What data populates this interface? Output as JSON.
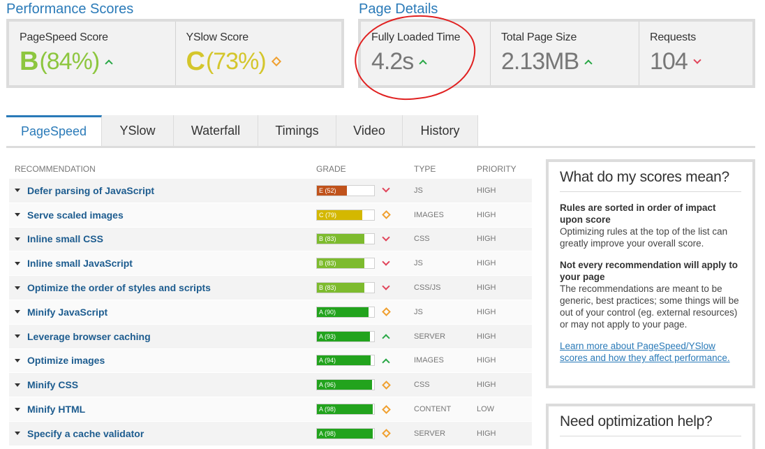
{
  "performance": {
    "title": "Performance Scores",
    "pagespeed": {
      "label": "PageSpeed Score",
      "grade": "B",
      "percent": "(84%)",
      "color": "#8dc63f",
      "trend": "up"
    },
    "yslow": {
      "label": "YSlow Score",
      "grade": "C",
      "percent": "(73%)",
      "color": "#d4c62c",
      "trend": "neutral"
    }
  },
  "details": {
    "title": "Page Details",
    "load_time": {
      "label": "Fully Loaded Time",
      "value": "4.2s",
      "trend": "up"
    },
    "page_size": {
      "label": "Total Page Size",
      "value": "2.13MB",
      "trend": "up"
    },
    "requests": {
      "label": "Requests",
      "value": "104",
      "trend": "down"
    }
  },
  "tabs": [
    {
      "label": "PageSpeed",
      "active": true
    },
    {
      "label": "YSlow"
    },
    {
      "label": "Waterfall"
    },
    {
      "label": "Timings"
    },
    {
      "label": "Video"
    },
    {
      "label": "History"
    }
  ],
  "table": {
    "headers": {
      "recommendation": "RECOMMENDATION",
      "grade": "GRADE",
      "type": "TYPE",
      "priority": "PRIORITY"
    },
    "rows": [
      {
        "name": "Defer parsing of JavaScript",
        "grade": "E (52)",
        "score": 52,
        "color": "#c0521b",
        "trend": "down",
        "type": "JS",
        "priority": "HIGH"
      },
      {
        "name": "Serve scaled images",
        "grade": "C (79)",
        "score": 79,
        "color": "#d4b800",
        "trend": "neutral",
        "type": "IMAGES",
        "priority": "HIGH"
      },
      {
        "name": "Inline small CSS",
        "grade": "B (83)",
        "score": 83,
        "color": "#7dbb2e",
        "trend": "down",
        "type": "CSS",
        "priority": "HIGH"
      },
      {
        "name": "Inline small JavaScript",
        "grade": "B (83)",
        "score": 83,
        "color": "#7dbb2e",
        "trend": "down",
        "type": "JS",
        "priority": "HIGH"
      },
      {
        "name": "Optimize the order of styles and scripts",
        "grade": "B (83)",
        "score": 83,
        "color": "#7dbb2e",
        "trend": "down",
        "type": "CSS/JS",
        "priority": "HIGH"
      },
      {
        "name": "Minify JavaScript",
        "grade": "A (90)",
        "score": 90,
        "color": "#22a31d",
        "trend": "neutral",
        "type": "JS",
        "priority": "HIGH"
      },
      {
        "name": "Leverage browser caching",
        "grade": "A (93)",
        "score": 93,
        "color": "#22a31d",
        "trend": "up",
        "type": "SERVER",
        "priority": "HIGH"
      },
      {
        "name": "Optimize images",
        "grade": "A (94)",
        "score": 94,
        "color": "#22a31d",
        "trend": "up",
        "type": "IMAGES",
        "priority": "HIGH"
      },
      {
        "name": "Minify CSS",
        "grade": "A (96)",
        "score": 96,
        "color": "#22a31d",
        "trend": "neutral",
        "type": "CSS",
        "priority": "HIGH"
      },
      {
        "name": "Minify HTML",
        "grade": "A (98)",
        "score": 98,
        "color": "#22a31d",
        "trend": "neutral",
        "type": "CONTENT",
        "priority": "LOW"
      },
      {
        "name": "Specify a cache validator",
        "grade": "A (98)",
        "score": 98,
        "color": "#22a31d",
        "trend": "neutral",
        "type": "SERVER",
        "priority": "HIGH"
      }
    ]
  },
  "sidebar": {
    "scores_title": "What do my scores mean?",
    "rule1_title": "Rules are sorted in order of impact upon score",
    "rule1_text": "Optimizing rules at the top of the list can greatly improve your overall score.",
    "rule2_title": "Not every recommendation will apply to your page",
    "rule2_text": "The recommendations are meant to be generic, best practices; some things will be out of your control (eg. external resources) or may not apply to your page.",
    "learn_link": "Learn more about PageSpeed/YSlow scores and how they affect performance.",
    "help_title": "Need optimization help?"
  }
}
